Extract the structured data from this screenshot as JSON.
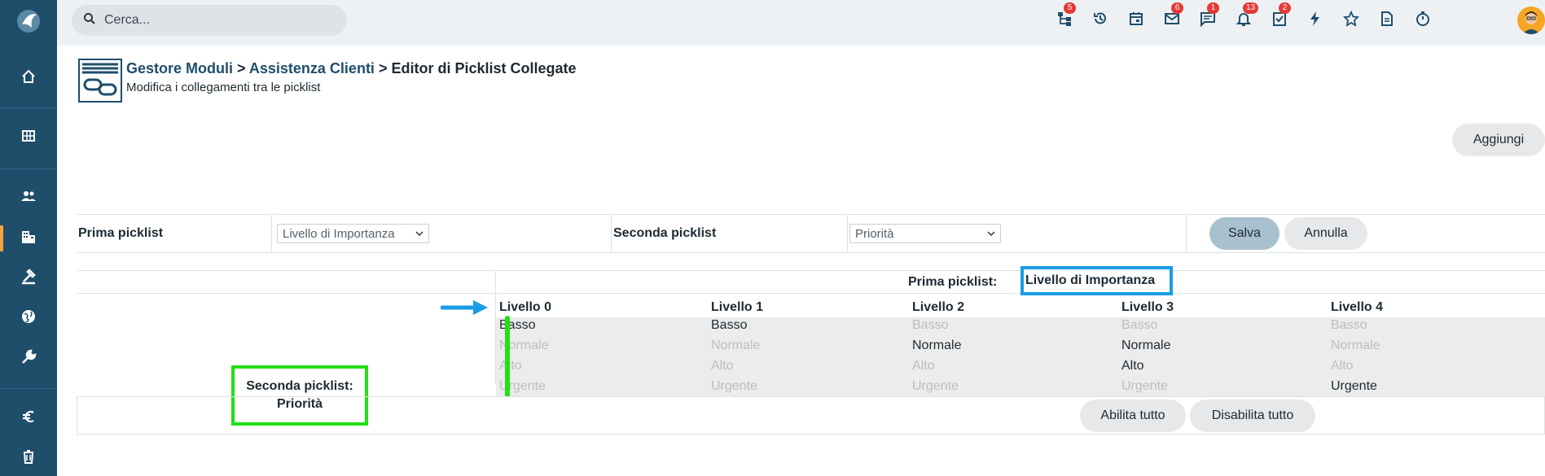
{
  "sidebar": {
    "items": [
      {
        "icon": "home-icon"
      },
      {
        "icon": "grid-icon"
      },
      {
        "icon": "contacts-icon"
      },
      {
        "icon": "building-icon",
        "active": true
      },
      {
        "icon": "hammer-icon"
      },
      {
        "icon": "globe-icon"
      },
      {
        "icon": "wrench-icon"
      },
      {
        "icon": "euro-icon"
      },
      {
        "icon": "trash-icon"
      }
    ]
  },
  "topbar": {
    "search_placeholder": "Cerca...",
    "icons": [
      {
        "icon": "hierarchy-icon",
        "badge": "5"
      },
      {
        "icon": "history-icon",
        "badge": ""
      },
      {
        "icon": "calendar-icon",
        "badge": ""
      },
      {
        "icon": "mail-icon",
        "badge": "6"
      },
      {
        "icon": "chat-icon",
        "badge": "1"
      },
      {
        "icon": "bell-icon",
        "badge": "13"
      },
      {
        "icon": "task-check-icon",
        "badge": "2"
      },
      {
        "icon": "lightning-icon",
        "badge": ""
      },
      {
        "icon": "star-icon",
        "badge": ""
      },
      {
        "icon": "document-icon",
        "badge": ""
      },
      {
        "icon": "timer-icon",
        "badge": ""
      }
    ]
  },
  "page": {
    "crumb1": "Gestore Moduli",
    "crumb2": "Assistenza Clienti",
    "crumb3": "Editor di Picklist Collegate",
    "sep": ">",
    "subtitle": "Modifica i collegamenti tra le picklist",
    "add_label": "Aggiungi"
  },
  "picklists": {
    "first_label": "Prima picklist",
    "first_value": "Livello di Importanza",
    "second_label": "Seconda picklist",
    "second_value": "Priorità",
    "save_label": "Salva",
    "cancel_label": "Annulla"
  },
  "matrix": {
    "header_label": "Prima picklist:",
    "header_value": "Livello di Importanza",
    "second_label": "Seconda picklist:",
    "second_value": "Priorità",
    "levels": [
      "Livello 0",
      "Livello 1",
      "Livello 2",
      "Livello 3",
      "Livello 4"
    ],
    "options": [
      "Basso",
      "Normale",
      "Alto",
      "Urgente"
    ],
    "enabled": [
      [
        true,
        false,
        false,
        false
      ],
      [
        true,
        false,
        false,
        false
      ],
      [
        false,
        true,
        false,
        false
      ],
      [
        false,
        true,
        true,
        false
      ],
      [
        false,
        false,
        false,
        true
      ]
    ],
    "enable_all_label": "Abilita tutto",
    "disable_all_label": "Disabilita tutto"
  },
  "colors": {
    "sidebar": "#1f4e6b",
    "highlight_blue": "#1a9be6",
    "highlight_green": "#22e014",
    "badge": "#e53935"
  }
}
